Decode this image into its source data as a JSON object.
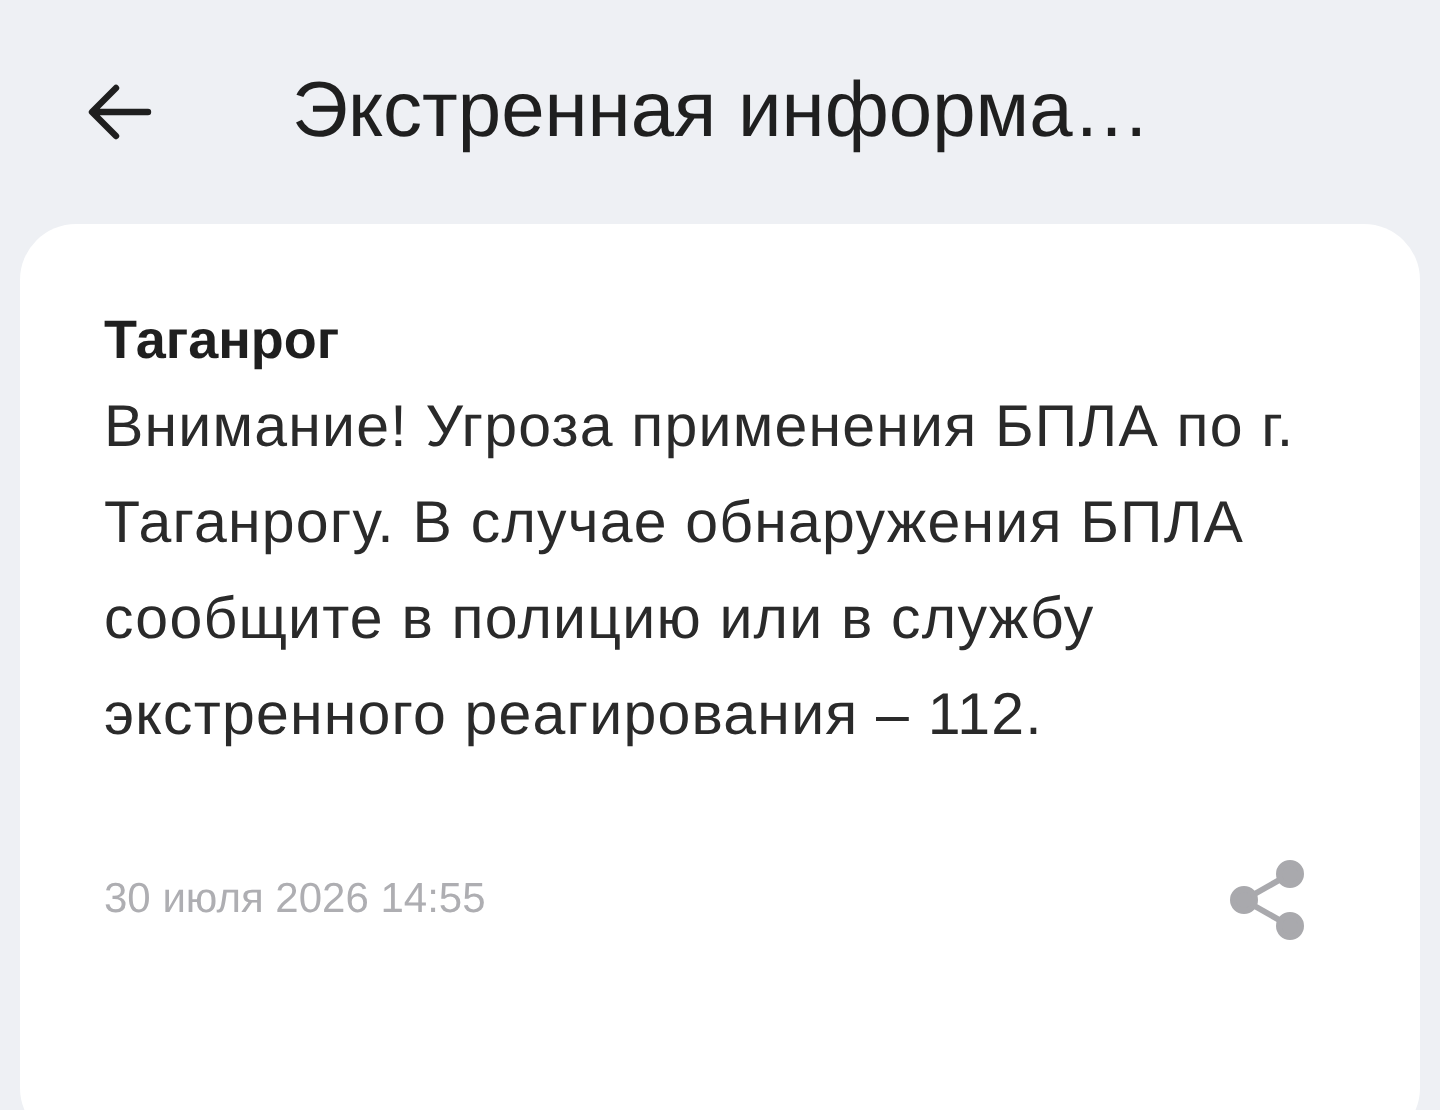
{
  "header": {
    "title": "Экстренная информа…"
  },
  "alert": {
    "city": "Таганрог",
    "message": "Внимание! Угроза применения БПЛА по г. Таганрогу. В случае обнаружения БПЛА сообщите в полицию или в службу экстренного реагирования – 112.",
    "date": "30 июля 2026 14:55"
  }
}
